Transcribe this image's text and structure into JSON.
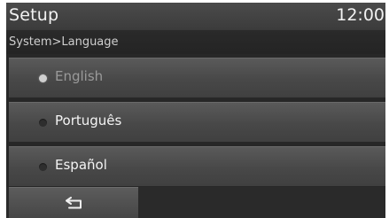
{
  "header": {
    "title": "Setup",
    "time": "12:00"
  },
  "breadcrumb": "System>Language",
  "languages": [
    {
      "label": "English",
      "selected": true
    },
    {
      "label": "Português",
      "selected": false
    },
    {
      "label": "Español",
      "selected": false
    }
  ],
  "footer": {
    "back_icon": "back-arrow-icon"
  }
}
